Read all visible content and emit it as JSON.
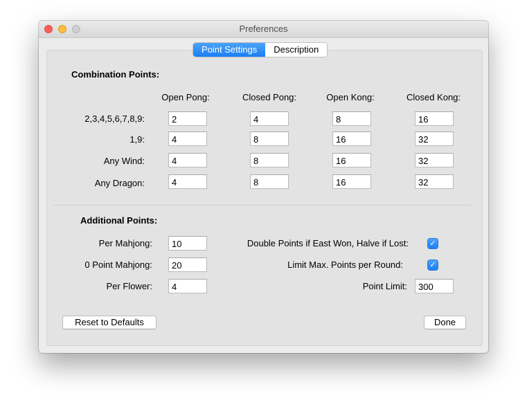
{
  "window": {
    "title": "Preferences"
  },
  "tabs": [
    {
      "label": "Point Settings"
    },
    {
      "label": "Description"
    }
  ],
  "combination": {
    "heading": "Combination Points:",
    "columns": [
      "Open Pong:",
      "Closed Pong:",
      "Open Kong:",
      "Closed Kong:"
    ],
    "rows": [
      {
        "label": "2,3,4,5,6,7,8,9:",
        "values": [
          "2",
          "4",
          "8",
          "16"
        ]
      },
      {
        "label": "1,9:",
        "values": [
          "4",
          "8",
          "16",
          "32"
        ]
      },
      {
        "label": "Any Wind:",
        "values": [
          "4",
          "8",
          "16",
          "32"
        ]
      },
      {
        "label": "Any Dragon:",
        "values": [
          "4",
          "8",
          "16",
          "32"
        ]
      }
    ]
  },
  "additional": {
    "heading": "Additional Points:",
    "per_mahjong_label": "Per Mahjong:",
    "per_mahjong_value": "10",
    "zero_point_label": "0 Point Mahjong:",
    "zero_point_value": "20",
    "per_flower_label": "Per Flower:",
    "per_flower_value": "4",
    "double_points_label": "Double Points if East Won, Halve if Lost:",
    "double_points_checked": true,
    "limit_label": "Limit Max. Points per Round:",
    "limit_checked": true,
    "point_limit_label": "Point Limit:",
    "point_limit_value": "300"
  },
  "buttons": {
    "reset": "Reset to Defaults",
    "done": "Done"
  },
  "icons": {
    "checkbox": "checkmark-icon"
  },
  "colors": {
    "accent": "#1d7ef4",
    "close": "#fc605c",
    "minimize": "#fdbc40"
  }
}
